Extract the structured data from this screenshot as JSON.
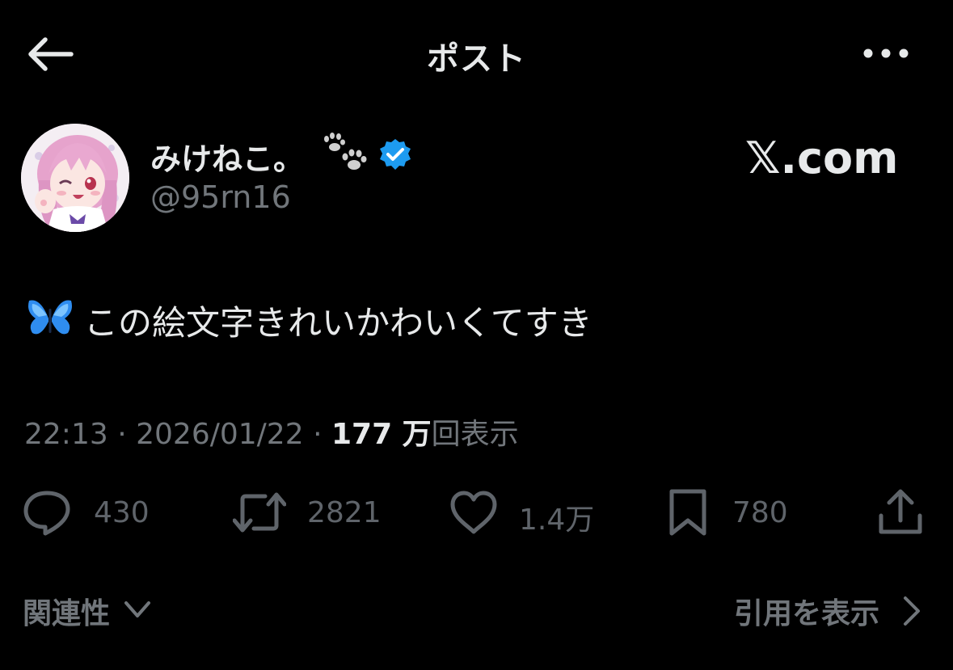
{
  "header": {
    "title": "ポスト",
    "back_icon": "arrow-left-icon",
    "more_icon": "more-horizontal-icon"
  },
  "author": {
    "display_name": "みけねこ。",
    "name_emoji": "paw-prints-icon",
    "verified_icon": "verified-badge-icon",
    "handle": "@95rn16",
    "avatar": "anime-girl-avatar"
  },
  "watermark": "𝕏.com",
  "tweet": {
    "emoji": "butterfly-icon",
    "text": "この絵文字きれいかわいくてすき"
  },
  "meta": {
    "time": "22:13",
    "separator": "·",
    "date": "2026/01/22",
    "views_count": "177 万",
    "views_label": "回表示"
  },
  "actions": {
    "replies": "430",
    "reposts": "2821",
    "likes": "1.4万",
    "bookmarks": "780"
  },
  "footer": {
    "related_label": "関連性",
    "quotes_label": "引用を表示"
  },
  "colors": {
    "background": "#000000",
    "primary_text": "#e7e9ea",
    "secondary_text": "#71767b",
    "verified_blue": "#1d9bf0"
  }
}
